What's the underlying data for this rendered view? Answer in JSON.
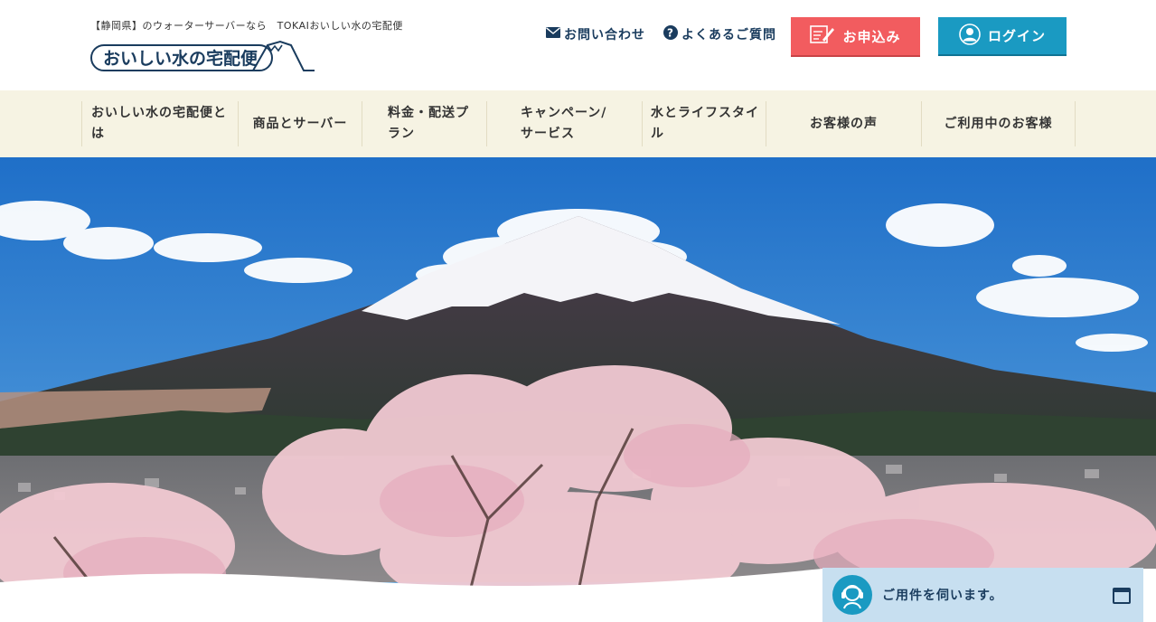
{
  "header": {
    "tagline": "【静岡県】のウォーターサーバーなら　TOKAIおいしい水の宅配便",
    "logo_text": "おいしい水の宅配便",
    "contact_label": "お問い合わせ",
    "faq_label": "よくあるご質問",
    "apply_label": "お申込み",
    "login_label": "ログイン"
  },
  "nav": {
    "items": [
      {
        "label": "おいしい水の宅配便とは"
      },
      {
        "label": "商品とサーバー"
      },
      {
        "label": "料金・配送プラン"
      },
      {
        "label": "キャンペーン/サービス"
      },
      {
        "label": "水とライフスタイル"
      },
      {
        "label": "お客様の声"
      },
      {
        "label": "ご利用中のお客様"
      }
    ]
  },
  "chat": {
    "label": "ご用件を伺います。"
  },
  "colors": {
    "navy": "#1a3c5e",
    "apply_red": "#f25c5f",
    "login_blue": "#1a9ac2",
    "nav_bg": "#f6f3e3",
    "chat_bg": "#c7dff0"
  }
}
